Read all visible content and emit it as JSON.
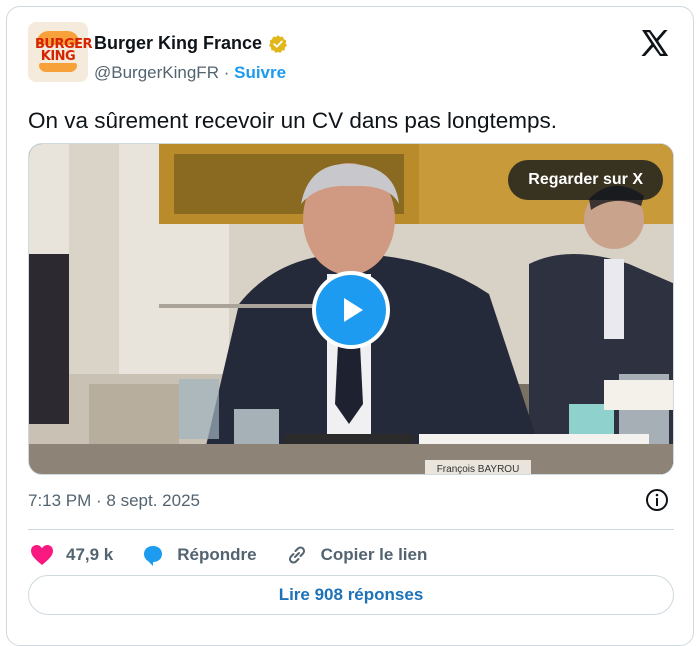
{
  "account": {
    "name": "Burger King France",
    "handle": "@BurgerKingFR",
    "separator": "·",
    "follow_label": "Suivre",
    "logo_text_line1": "BURGER",
    "logo_text_line2": "KING"
  },
  "tweet": {
    "text": "On va sûrement recevoir un CV dans pas longtemps.",
    "timestamp": "7:13 PM · 8 sept. 2025"
  },
  "media": {
    "watch_label": "Regarder sur X",
    "nameplate_text": "François BAYROU",
    "play_icon": "play-icon"
  },
  "actions": {
    "likes_count": "47,9 k",
    "reply_label": "Répondre",
    "copy_link_label": "Copier le lien",
    "read_replies_label": "Lire 908 réponses"
  },
  "colors": {
    "accent": "#1d9bf0",
    "like": "#f91880",
    "verified_gold": "#e2b719",
    "text_primary": "#0f1419",
    "text_secondary": "#536471",
    "border": "#cfd9de"
  }
}
